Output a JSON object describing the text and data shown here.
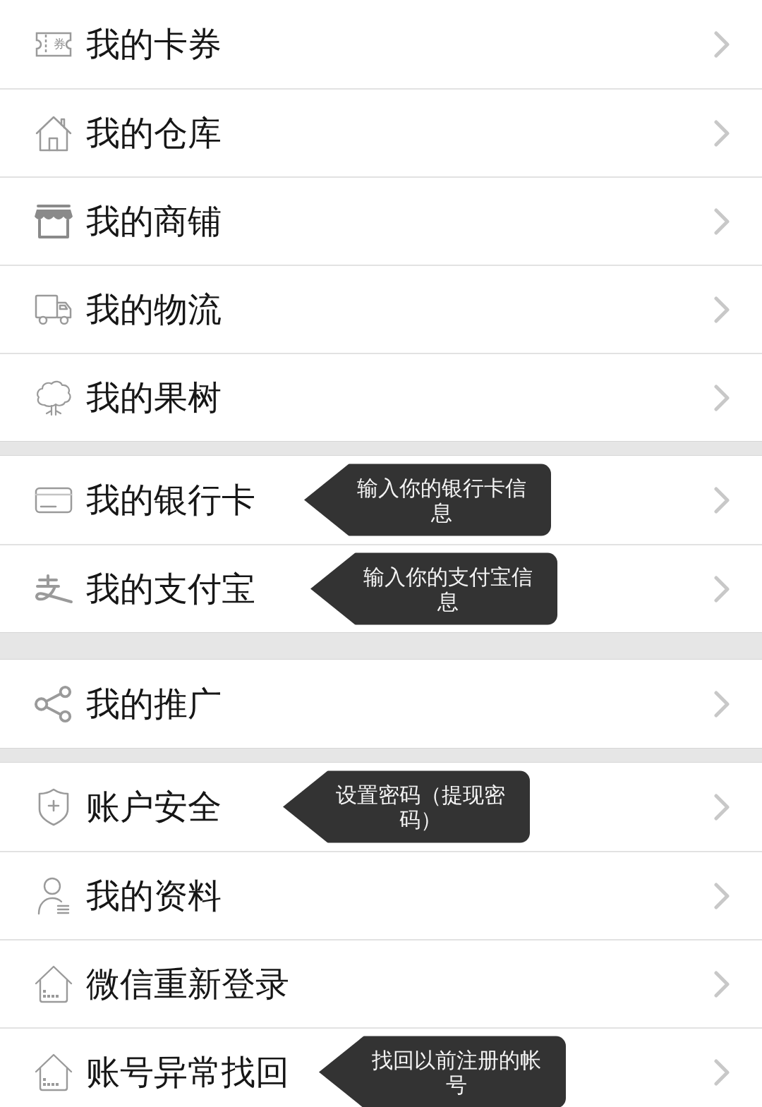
{
  "groups": [
    {
      "items": [
        {
          "kind": "coupon",
          "label": "我的卡券",
          "icon_text": "券"
        },
        {
          "kind": "warehouse",
          "label": "我的仓库"
        },
        {
          "kind": "shop",
          "label": "我的商铺"
        },
        {
          "kind": "logistics",
          "label": "我的物流"
        },
        {
          "kind": "tree",
          "label": "我的果树"
        }
      ]
    },
    {
      "items": [
        {
          "kind": "bankcard",
          "label": "我的银行卡",
          "tip": "输入你的银行卡信息"
        },
        {
          "kind": "alipay",
          "label": "我的支付宝",
          "tip": "输入你的支付宝信息"
        }
      ]
    },
    {
      "items": [
        {
          "kind": "promotion",
          "label": "我的推广"
        }
      ]
    },
    {
      "items": [
        {
          "kind": "security",
          "label": "账户安全",
          "tip": "设置密码（提现密码）"
        },
        {
          "kind": "profile",
          "label": "我的资料"
        },
        {
          "kind": "relogin",
          "label": "微信重新登录"
        },
        {
          "kind": "recovery",
          "label": "账号异常找回",
          "tip": "找回以前注册的帐号"
        }
      ]
    }
  ]
}
